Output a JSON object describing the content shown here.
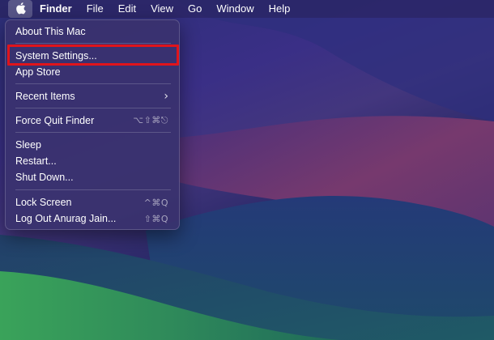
{
  "menubar": {
    "apple_icon": "apple-logo-icon",
    "items": [
      "Finder",
      "File",
      "Edit",
      "View",
      "Go",
      "Window",
      "Help"
    ]
  },
  "apple_menu": {
    "items": [
      {
        "label": "About This Mac",
        "shortcut": ""
      },
      {
        "label": "System Settings...",
        "shortcut": ""
      },
      {
        "label": "App Store",
        "shortcut": ""
      },
      {
        "label": "Recent Items",
        "shortcut": "",
        "submenu_icon": "chevron-right-icon"
      },
      {
        "label": "Force Quit Finder",
        "shortcut": "⌥⇧⌘⎋"
      },
      {
        "label": "Sleep",
        "shortcut": ""
      },
      {
        "label": "Restart...",
        "shortcut": ""
      },
      {
        "label": "Shut Down...",
        "shortcut": ""
      },
      {
        "label": "Lock Screen",
        "shortcut": "^⌘Q"
      },
      {
        "label": "Log Out Anurag Jain...",
        "shortcut": "⇧⌘Q"
      }
    ],
    "highlighted_item": "System Settings...",
    "highlight_color": "#e0141b"
  },
  "colors": {
    "menu_background": "#3a326e",
    "menu_text": "#ffffff",
    "wallpaper_purple": "#3a2f86",
    "wallpaper_magenta": "#7a3a6e",
    "wallpaper_green": "#2f8a5a"
  }
}
